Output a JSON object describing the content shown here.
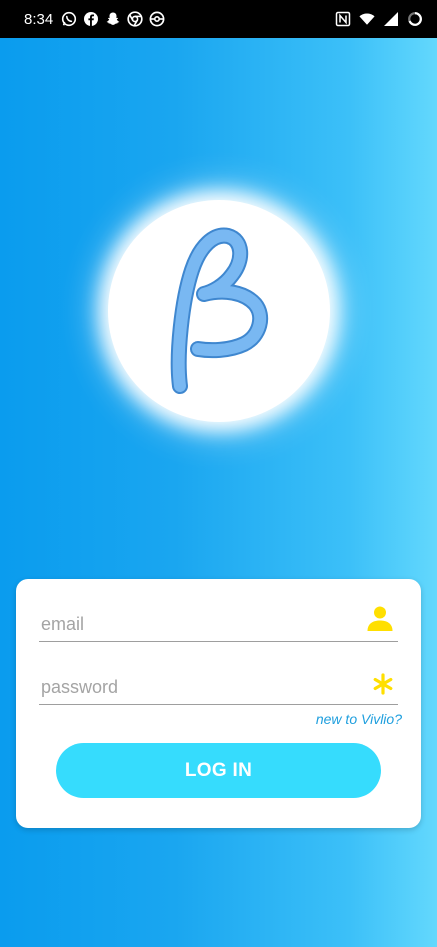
{
  "status_bar": {
    "time": "8:34",
    "left_icons": [
      "whatsapp-icon",
      "facebook-icon",
      "snapchat-icon",
      "chrome-icon",
      "pokeball-icon"
    ],
    "right_icons": [
      "nfc-icon",
      "wifi-icon",
      "signal-icon",
      "battery-charging-icon"
    ]
  },
  "logo": {
    "glyph_name": "beta-logo",
    "color": "#74b4f0"
  },
  "login_form": {
    "email_placeholder": "email",
    "email_value": "",
    "email_icon": "user-icon",
    "password_placeholder": "password",
    "password_value": "",
    "password_icon": "asterisk-icon",
    "signup_link": "new to Vivlio?",
    "login_button": "LOG IN"
  },
  "colors": {
    "background_start": "#0a9cee",
    "background_end": "#63d8fd",
    "accent_button": "#36dcfd",
    "link": "#1f9fde",
    "field_icons": "#ffdf00"
  }
}
